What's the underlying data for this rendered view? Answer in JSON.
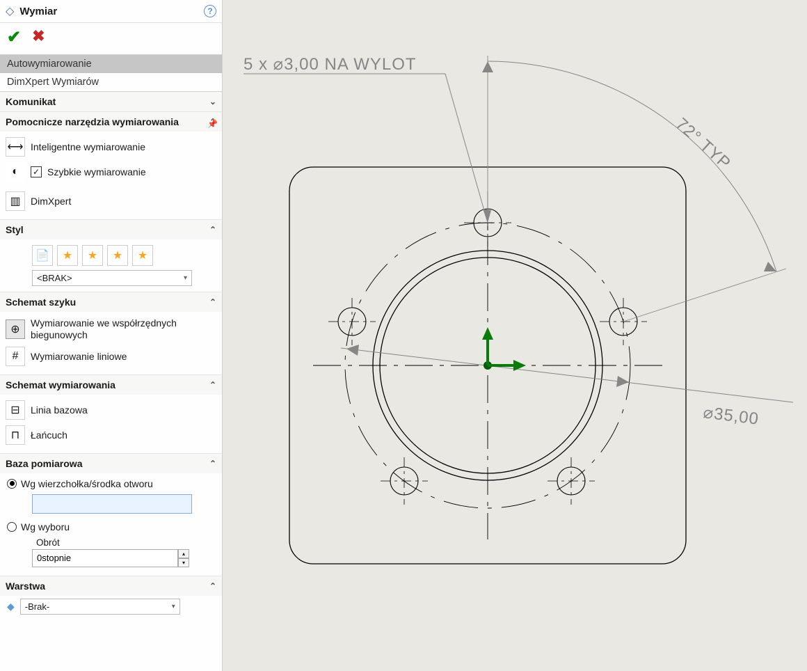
{
  "header": {
    "title": "Wymiar"
  },
  "tabs": {
    "auto": "Autowymiarowanie",
    "dimxpert": "DimXpert Wymiarów"
  },
  "sections": {
    "komunikat": "Komunikat",
    "pomocnicze": "Pomocnicze narzędzia wymiarowania",
    "styl": "Styl",
    "szyk": "Schemat szyku",
    "schemat_wym": "Schemat wymiarowania",
    "baza": "Baza pomiarowa",
    "warstwa": "Warstwa"
  },
  "tools": {
    "inteligentne": "Inteligentne wymiarowanie",
    "szybkie": "Szybkie wymiarowanie",
    "dimxpert": "DimXpert"
  },
  "style": {
    "default": "<BRAK>"
  },
  "szyk": {
    "biegunowe": "Wymiarowanie we współrzędnych biegunowych",
    "liniowe": "Wymiarowanie liniowe"
  },
  "schemat_wym": {
    "bazowa": "Linia bazowa",
    "lancuch": "Łańcuch"
  },
  "baza": {
    "wierzcholek": "Wg wierzchołka/środka otworu",
    "wybor": "Wg wyboru",
    "obrot_label": "Obrót",
    "obrot_value": "0stopnie"
  },
  "warstwa": {
    "value": "-Brak-"
  },
  "drawing": {
    "hole_callout": "5 x  ⌀3,00 NA WYLOT",
    "angle": "72° TYP",
    "diameter": "⌀35,00"
  }
}
